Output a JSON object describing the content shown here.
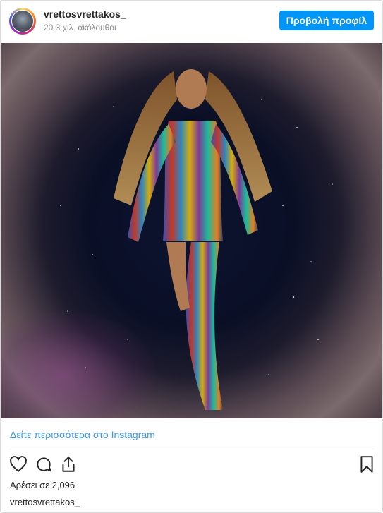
{
  "header": {
    "username": "vrettosvrettakos_",
    "followers": "20.3 χιλ. ακόλουθοι",
    "view_profile_label": "Προβολή προφίλ"
  },
  "post": {
    "image_icon": "photo",
    "see_more_label": "Δείτε περισσότερα στο Instagram",
    "likes_text": "Αρέσει σε 2,096",
    "caption_username": "vrettosvrettakos_"
  },
  "actions": {
    "like_icon": "heart-icon",
    "comment_icon": "comment-icon",
    "share_icon": "share-icon",
    "save_icon": "bookmark-icon"
  },
  "colors": {
    "button": "#0095f6",
    "link": "#3897f0",
    "text": "#262626",
    "muted": "#8e8e8e"
  }
}
